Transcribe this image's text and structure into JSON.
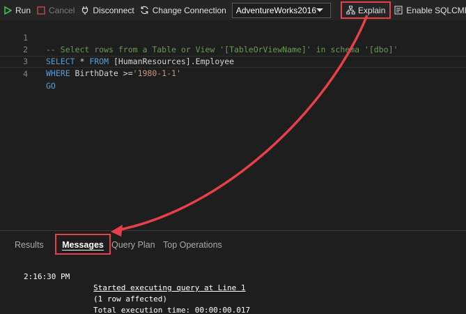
{
  "toolbar": {
    "run_label": "Run",
    "cancel_label": "Cancel",
    "disconnect_label": "Disconnect",
    "change_connection_label": "Change Connection",
    "database": "AdventureWorks2016",
    "explain_label": "Explain",
    "sqlcmd_label": "Enable SQLCMD"
  },
  "editor": {
    "lines": [
      {
        "num": "1",
        "comment": "-- Select rows from a Table or View '[TableOrViewName]' in schema '[dbo]'"
      },
      {
        "num": "2",
        "kw": "SELECT",
        "mid": " * ",
        "kw2": "FROM",
        "rest": " [HumanResources].Employee"
      },
      {
        "num": "3",
        "kw": "WHERE",
        "rest": " BirthDate >=",
        "str": "'1980-1-1'"
      },
      {
        "num": "4",
        "kw": "GO"
      }
    ]
  },
  "panel": {
    "tabs": [
      "Results",
      "Messages",
      "Query Plan",
      "Top Operations"
    ],
    "messages": [
      {
        "time": "2:16:30 PM",
        "text": "Started executing query at Line 1"
      },
      {
        "time": "",
        "text": "(1 row affected)"
      },
      {
        "time": "",
        "text": "Total execution time: 00:00:00.017"
      }
    ]
  },
  "colors": {
    "highlight": "#e8404a",
    "keyword": "#569cd6",
    "comment": "#6a9955",
    "string": "#ce9178"
  }
}
